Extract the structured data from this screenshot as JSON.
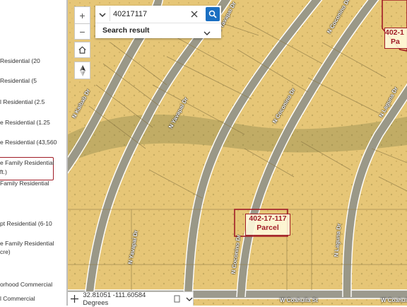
{
  "legend": {
    "items": [
      {
        "label": "Residential (20"
      },
      {
        "label": "Residential (5"
      },
      {
        "label": "l Residential (2.5"
      },
      {
        "label": "e Residential (1.25"
      },
      {
        "label": "e Residential (43,560"
      },
      {
        "label": "e Family Residential"
      },
      {
        "label": "ft.)"
      },
      {
        "label": "Family Residential"
      },
      {
        "label": "pt Residential (6-10"
      },
      {
        "label": "e Family Residential"
      },
      {
        "label": "cre)"
      },
      {
        "label": "orhood Commercial"
      },
      {
        "label": "l Commercial"
      }
    ]
  },
  "map": {
    "zoom_in_label": "+",
    "zoom_out_label": "−",
    "search": {
      "value": "40217117",
      "result_label": "Search result"
    },
    "parcels": [
      {
        "line1": "402-17-117",
        "line2": "Parcel"
      },
      {
        "line1": "402-1",
        "line2": "Pa"
      }
    ],
    "streets": [
      "N Kaibab Dr",
      "N Yavapai Dr",
      "N Yavapai Dr",
      "N Coconino Dr",
      "N Coconino Dr",
      "N Coconino Dr",
      "N Laguna Dr",
      "N Laguna Dr",
      "W Coahuila St",
      "W Coahuil"
    ],
    "coordinates": "32.81051 -111.60584 Degrees"
  },
  "colors": {
    "parcel_outline": "#a01b26",
    "map_fill": "#e8c776",
    "search_button": "#1b6fc2"
  }
}
